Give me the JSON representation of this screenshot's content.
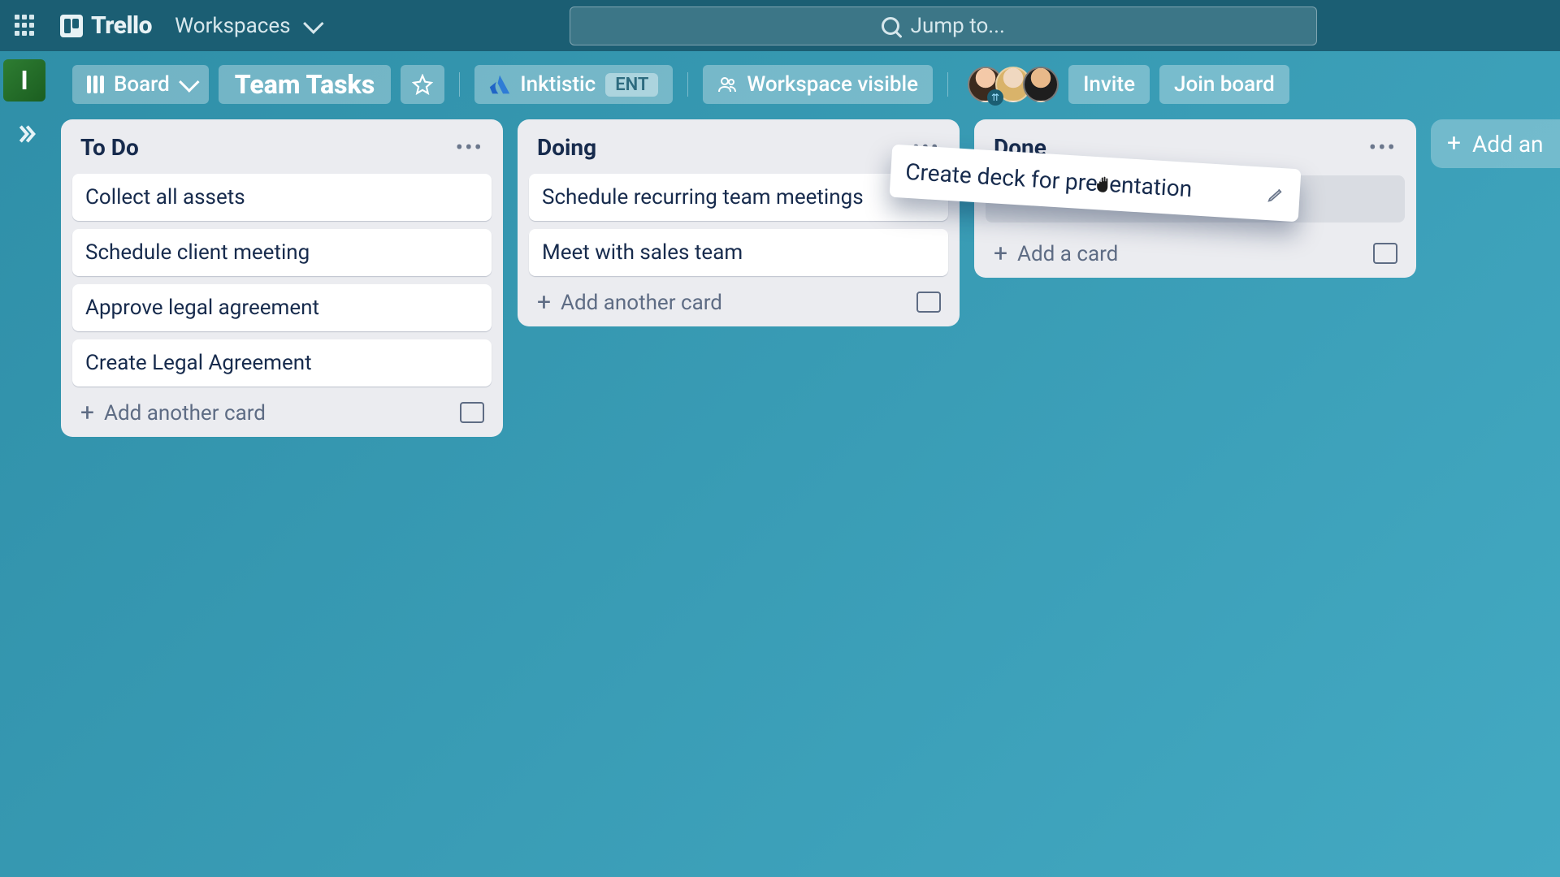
{
  "header": {
    "logo_text": "Trello",
    "workspaces_label": "Workspaces",
    "search_placeholder": "Jump to..."
  },
  "board_bar": {
    "workspace_initial": "I",
    "view_label": "Board",
    "board_title": "Team Tasks",
    "org_name": "Inktistic",
    "org_badge": "ENT",
    "visibility_label": "Workspace visible",
    "invite_label": "Invite",
    "join_label": "Join board"
  },
  "lists": [
    {
      "title": "To Do",
      "cards": [
        "Collect all assets",
        "Schedule client meeting",
        "Approve legal agreement",
        "Create Legal Agreement"
      ],
      "add_label": "Add another card"
    },
    {
      "title": "Doing",
      "cards": [
        "Schedule recurring team meetings",
        "Meet with sales team"
      ],
      "add_label": "Add another card"
    },
    {
      "title": "Done",
      "cards": [],
      "add_label": "Add a card"
    }
  ],
  "dragging_card": {
    "text": "Create deck for presentation"
  },
  "add_list_label": "Add an"
}
